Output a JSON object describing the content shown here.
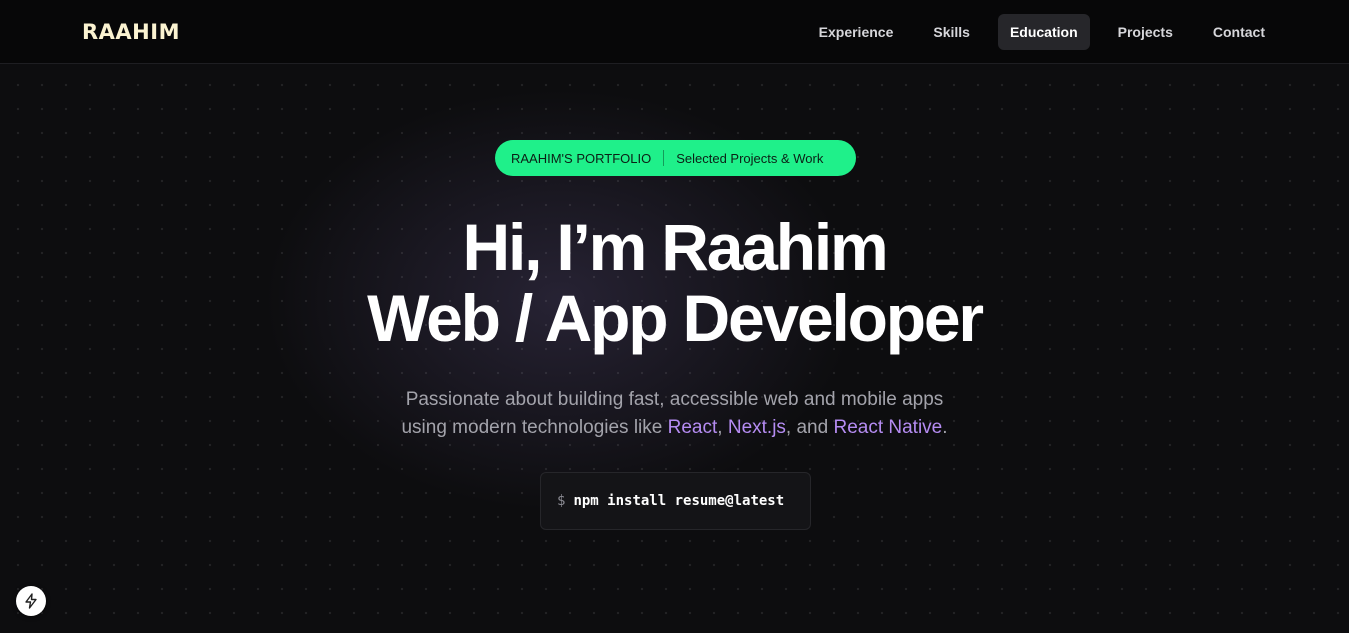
{
  "nav": {
    "logo": "RAAHIM",
    "links": [
      {
        "label": "Experience"
      },
      {
        "label": "Skills"
      },
      {
        "label": "Education",
        "active": true
      },
      {
        "label": "Projects"
      },
      {
        "label": "Contact"
      }
    ]
  },
  "hero": {
    "badge": {
      "left": "RAAHIM'S PORTFOLIO",
      "right": "Selected Projects & Work"
    },
    "headline_line1": "Hi, I’m Raahim",
    "headline_line2": "Web / App Developer",
    "subtitle": {
      "line1": "Passionate about building fast, accessible web and mobile apps",
      "line2_prefix": "using modern technologies like ",
      "tech1": "React",
      "sep1": ", ",
      "tech2": "Next.js",
      "sep2": ", and ",
      "tech3": "React Native",
      "end": "."
    },
    "terminal": {
      "prompt": "$",
      "command": "npm install resume@latest"
    }
  },
  "floating_button": {
    "icon": "bolt-icon"
  },
  "colors": {
    "accent_green": "#1ff08a",
    "tech_purple": "#b58cf2",
    "background": "#0d0d0f",
    "logo": "#fbf3d1"
  }
}
